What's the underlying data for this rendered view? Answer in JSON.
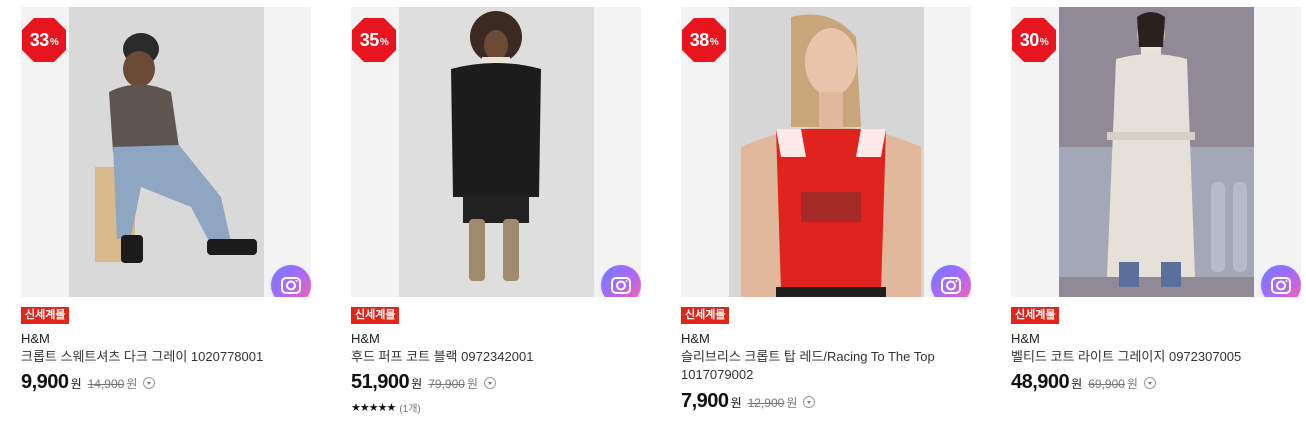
{
  "products": [
    {
      "discount": "33",
      "discount_unit": "%",
      "badge": "신세계몰",
      "brand": "H&M",
      "name": "크롭트 스웨트셔츠 다크 그레이 1020778001",
      "price": "9,900",
      "price_unit": "원",
      "original_price": "14,900",
      "original_unit": "원",
      "camera_icon": "camera-icon"
    },
    {
      "discount": "35",
      "discount_unit": "%",
      "badge": "신세계몰",
      "brand": "H&M",
      "name": "후드 퍼프 코트 블랙 0972342001",
      "price": "51,900",
      "price_unit": "원",
      "original_price": "79,900",
      "original_unit": "원",
      "rating_stars": "★★★★★",
      "rating_count": "(1개)",
      "camera_icon": "camera-icon"
    },
    {
      "discount": "38",
      "discount_unit": "%",
      "badge": "신세계몰",
      "brand": "H&M",
      "name": "슬리브리스 크롭트 탑 레드/Racing To The Top 1017079002",
      "price": "7,900",
      "price_unit": "원",
      "original_price": "12,900",
      "original_unit": "원",
      "camera_icon": "camera-icon"
    },
    {
      "discount": "30",
      "discount_unit": "%",
      "badge": "신세계몰",
      "brand": "H&M",
      "name": "벨티드 코트 라이트 그레이지 0972307005",
      "price": "48,900",
      "price_unit": "원",
      "original_price": "69,900",
      "original_unit": "원",
      "camera_icon": "camera-icon"
    }
  ],
  "colors": {
    "discount_red": "#e8141e",
    "badge_red": "#e1251b",
    "camera_gradient": [
      "#6e7cff",
      "#a36bff",
      "#ff5fa8"
    ]
  }
}
